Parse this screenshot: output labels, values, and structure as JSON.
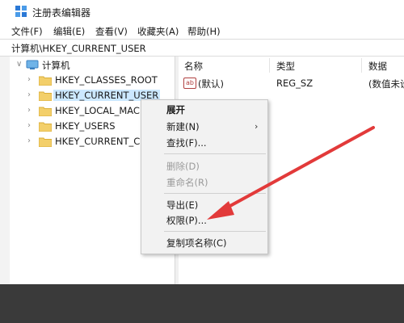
{
  "window": {
    "title": "注册表编辑器",
    "icon": "registry-editor-icon"
  },
  "menubar": {
    "items": [
      "文件(F)",
      "编辑(E)",
      "查看(V)",
      "收藏夹(A)",
      "帮助(H)"
    ]
  },
  "address": {
    "path": "计算机\\HKEY_CURRENT_USER"
  },
  "tree": {
    "root": "计算机",
    "items": [
      "HKEY_CLASSES_ROOT",
      "HKEY_CURRENT_USER",
      "HKEY_LOCAL_MACH",
      "HKEY_USERS",
      "HKEY_CURRENT_CO"
    ],
    "selected_index": 1
  },
  "list": {
    "columns": [
      "名称",
      "类型",
      "数据"
    ],
    "rows": [
      {
        "name": "(默认)",
        "type": "REG_SZ",
        "data": "(数值未设"
      }
    ]
  },
  "context_menu": {
    "expand": "展开",
    "new": "新建(N)",
    "find": "查找(F)...",
    "delete": "删除(D)",
    "rename": "重命名(R)",
    "export": "导出(E)",
    "permissions": "权限(P)...",
    "copy_key_name": "复制项名称(C)"
  },
  "colors": {
    "selection": "#cce8ff",
    "annotation_arrow": "#e23a3a",
    "folder": "#f3cf6a"
  }
}
